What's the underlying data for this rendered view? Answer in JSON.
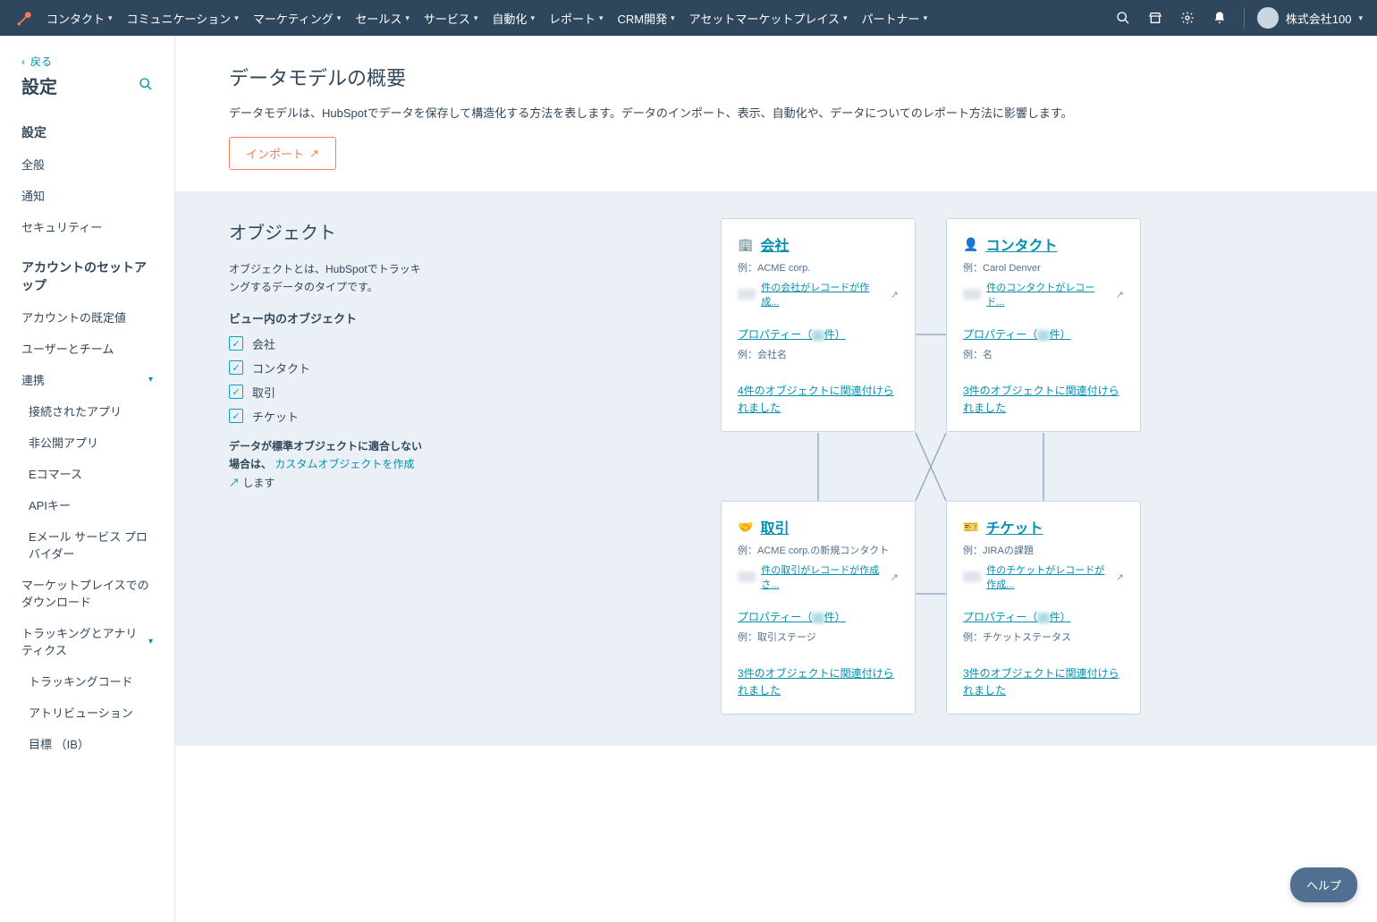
{
  "topnav": {
    "menu": [
      "コンタクト",
      "コミュニケーション",
      "マーケティング",
      "セールス",
      "サービス",
      "自動化",
      "レポート",
      "CRM開発",
      "アセットマーケットプレイス",
      "パートナー"
    ],
    "account_name": "株式会社100"
  },
  "sidebar": {
    "back": "戻る",
    "title": "設定",
    "section1_head": "設定",
    "section1_items": [
      "全般",
      "通知",
      "セキュリティー"
    ],
    "section2_head": "アカウントのセットアップ",
    "section2_items": [
      "アカウントの既定値",
      "ユーザーとチーム",
      "連携"
    ],
    "section2_sub": [
      "接続されたアプリ",
      "非公開アプリ",
      "Eコマース",
      "APIキー",
      "Eメール サービス プロバイダー"
    ],
    "section2_items2": [
      "マーケットプレイスでのダウンロード",
      "トラッキングとアナリティクス"
    ],
    "section2_sub2": [
      "トラッキングコード",
      "アトリビューション",
      "目標 （IB）"
    ]
  },
  "header": {
    "title": "データモデルの概要",
    "desc": "データモデルは、HubSpotでデータを保存して構造化する方法を表します。データのインポート、表示、自動化や、データについてのレポート方法に影響します。",
    "import_btn": "インポート"
  },
  "obj_panel": {
    "title": "オブジェクト",
    "desc": "オブジェクトとは、HubSpotでトラッキングするデータのタイプです。",
    "subhead": "ビュー内のオブジェクト",
    "checks": [
      "会社",
      "コンタクト",
      "取引",
      "チケット"
    ],
    "custom_pre": "データが標準オブジェクトに適合しない場合は、",
    "custom_link": "カスタムオブジェクトを作成",
    "custom_post": " します"
  },
  "cards": [
    {
      "title": "会社",
      "example": "例：ACME corp.",
      "rec": "件の会社がレコードが作成...",
      "props": "プロパティー（",
      "props_count": "",
      "props_suffix": "件）",
      "prop_ex": "例：会社名",
      "assoc": "4件のオブジェクトに関連付けられました"
    },
    {
      "title": "コンタクト",
      "example": "例：Carol Denver",
      "rec": "件のコンタクトがレコード...",
      "props": "プロパティー（",
      "props_count": "",
      "props_suffix": "件）",
      "prop_ex": "例：名",
      "assoc": "3件のオブジェクトに関連付けられました"
    },
    {
      "title": "取引",
      "example": "例：ACME corp.の新規コンタクト",
      "rec": "件の取引がレコードが作成さ...",
      "props": "プロパティー（",
      "props_count": "",
      "props_suffix": "件）",
      "prop_ex": "例：取引ステージ",
      "assoc": "3件のオブジェクトに関連付けられました"
    },
    {
      "title": "チケット",
      "example": "例：JIRAの課題",
      "rec": "件のチケットがレコードが作成...",
      "props": "プロパティー（",
      "props_count": "",
      "props_suffix": "件）",
      "prop_ex": "例：チケットステータス",
      "assoc": "3件のオブジェクトに関連付けられました"
    }
  ],
  "help": "ヘルプ",
  "icons": {
    "external": "↗"
  }
}
